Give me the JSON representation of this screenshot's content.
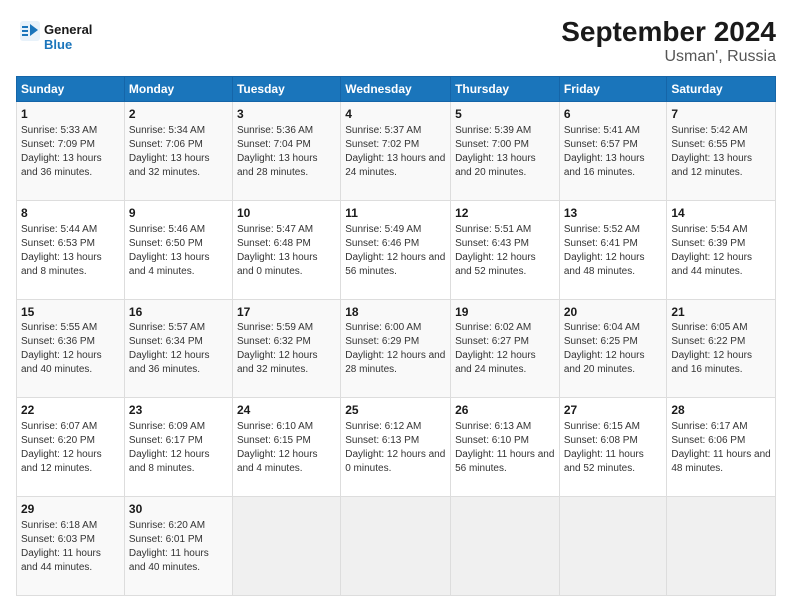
{
  "logo": {
    "name1": "General",
    "name2": "Blue"
  },
  "title": "September 2024",
  "subtitle": "Usman', Russia",
  "headers": [
    "Sunday",
    "Monday",
    "Tuesday",
    "Wednesday",
    "Thursday",
    "Friday",
    "Saturday"
  ],
  "weeks": [
    [
      {
        "day": "1",
        "sunrise": "5:33 AM",
        "sunset": "7:09 PM",
        "daylight": "13 hours and 36 minutes."
      },
      {
        "day": "2",
        "sunrise": "5:34 AM",
        "sunset": "7:06 PM",
        "daylight": "13 hours and 32 minutes."
      },
      {
        "day": "3",
        "sunrise": "5:36 AM",
        "sunset": "7:04 PM",
        "daylight": "13 hours and 28 minutes."
      },
      {
        "day": "4",
        "sunrise": "5:37 AM",
        "sunset": "7:02 PM",
        "daylight": "13 hours and 24 minutes."
      },
      {
        "day": "5",
        "sunrise": "5:39 AM",
        "sunset": "7:00 PM",
        "daylight": "13 hours and 20 minutes."
      },
      {
        "day": "6",
        "sunrise": "5:41 AM",
        "sunset": "6:57 PM",
        "daylight": "13 hours and 16 minutes."
      },
      {
        "day": "7",
        "sunrise": "5:42 AM",
        "sunset": "6:55 PM",
        "daylight": "13 hours and 12 minutes."
      }
    ],
    [
      {
        "day": "8",
        "sunrise": "5:44 AM",
        "sunset": "6:53 PM",
        "daylight": "13 hours and 8 minutes."
      },
      {
        "day": "9",
        "sunrise": "5:46 AM",
        "sunset": "6:50 PM",
        "daylight": "13 hours and 4 minutes."
      },
      {
        "day": "10",
        "sunrise": "5:47 AM",
        "sunset": "6:48 PM",
        "daylight": "13 hours and 0 minutes."
      },
      {
        "day": "11",
        "sunrise": "5:49 AM",
        "sunset": "6:46 PM",
        "daylight": "12 hours and 56 minutes."
      },
      {
        "day": "12",
        "sunrise": "5:51 AM",
        "sunset": "6:43 PM",
        "daylight": "12 hours and 52 minutes."
      },
      {
        "day": "13",
        "sunrise": "5:52 AM",
        "sunset": "6:41 PM",
        "daylight": "12 hours and 48 minutes."
      },
      {
        "day": "14",
        "sunrise": "5:54 AM",
        "sunset": "6:39 PM",
        "daylight": "12 hours and 44 minutes."
      }
    ],
    [
      {
        "day": "15",
        "sunrise": "5:55 AM",
        "sunset": "6:36 PM",
        "daylight": "12 hours and 40 minutes."
      },
      {
        "day": "16",
        "sunrise": "5:57 AM",
        "sunset": "6:34 PM",
        "daylight": "12 hours and 36 minutes."
      },
      {
        "day": "17",
        "sunrise": "5:59 AM",
        "sunset": "6:32 PM",
        "daylight": "12 hours and 32 minutes."
      },
      {
        "day": "18",
        "sunrise": "6:00 AM",
        "sunset": "6:29 PM",
        "daylight": "12 hours and 28 minutes."
      },
      {
        "day": "19",
        "sunrise": "6:02 AM",
        "sunset": "6:27 PM",
        "daylight": "12 hours and 24 minutes."
      },
      {
        "day": "20",
        "sunrise": "6:04 AM",
        "sunset": "6:25 PM",
        "daylight": "12 hours and 20 minutes."
      },
      {
        "day": "21",
        "sunrise": "6:05 AM",
        "sunset": "6:22 PM",
        "daylight": "12 hours and 16 minutes."
      }
    ],
    [
      {
        "day": "22",
        "sunrise": "6:07 AM",
        "sunset": "6:20 PM",
        "daylight": "12 hours and 12 minutes."
      },
      {
        "day": "23",
        "sunrise": "6:09 AM",
        "sunset": "6:17 PM",
        "daylight": "12 hours and 8 minutes."
      },
      {
        "day": "24",
        "sunrise": "6:10 AM",
        "sunset": "6:15 PM",
        "daylight": "12 hours and 4 minutes."
      },
      {
        "day": "25",
        "sunrise": "6:12 AM",
        "sunset": "6:13 PM",
        "daylight": "12 hours and 0 minutes."
      },
      {
        "day": "26",
        "sunrise": "6:13 AM",
        "sunset": "6:10 PM",
        "daylight": "11 hours and 56 minutes."
      },
      {
        "day": "27",
        "sunrise": "6:15 AM",
        "sunset": "6:08 PM",
        "daylight": "11 hours and 52 minutes."
      },
      {
        "day": "28",
        "sunrise": "6:17 AM",
        "sunset": "6:06 PM",
        "daylight": "11 hours and 48 minutes."
      }
    ],
    [
      {
        "day": "29",
        "sunrise": "6:18 AM",
        "sunset": "6:03 PM",
        "daylight": "11 hours and 44 minutes."
      },
      {
        "day": "30",
        "sunrise": "6:20 AM",
        "sunset": "6:01 PM",
        "daylight": "11 hours and 40 minutes."
      },
      null,
      null,
      null,
      null,
      null
    ]
  ]
}
